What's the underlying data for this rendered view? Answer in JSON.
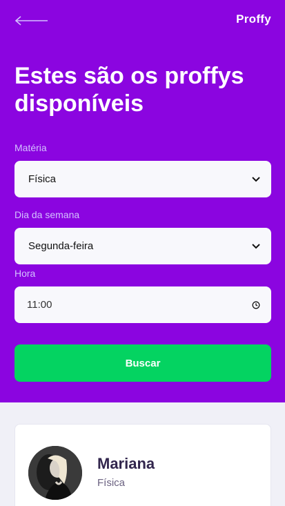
{
  "header": {
    "logo": "Proffy",
    "title": "Estes são os proffys disponíveis"
  },
  "filters": {
    "subject_label": "Matéria",
    "subject_value": "Física",
    "day_label": "Dia da semana",
    "day_value": "Segunda-feira",
    "time_label": "Hora",
    "time_value": "11:00"
  },
  "search_button": "Buscar",
  "teacher": {
    "name": "Mariana",
    "subject": "Física"
  },
  "colors": {
    "primary": "#8b05e0",
    "accent": "#04d361",
    "background": "#f0f0f7"
  },
  "icons": {
    "back": "arrow-left-icon",
    "select": "chevron-down-icon",
    "time": "clock-icon"
  }
}
